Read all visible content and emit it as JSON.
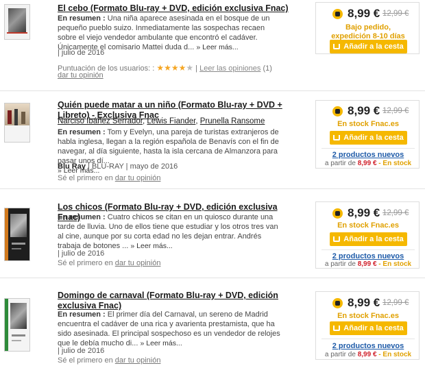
{
  "products": [
    {
      "title": "El cebo (Formato Blu-ray + DVD, edición exclusiva Fnac)",
      "summary_label": "En resumen :",
      "summary": "Una niña aparece asesinada en el bosque de un pequeño pueblo suizo. Inmediatamente las sospechas recaen sobre el viejo vendedor ambulante que encontró el cadáver. Únicamente el comisario Mattei duda d...",
      "more": "» Leer más...",
      "meta": "| julio de 2016",
      "rating_label": "Puntuación de los usuarios: :",
      "rating_stars": 4,
      "read_opinions": "Leer las opiniones",
      "opinions_count": "(1)",
      "opinion_link": "dar tu opinión",
      "price": "8,99 €",
      "old_price": "12,99 €",
      "availability": "Bajo pedido, expedición 8-10 días",
      "cart": "Añadir a la cesta"
    },
    {
      "title": "Quién puede matar a un niño (Formato Blu-ray + DVD + Libreto) - Exclusiva Fnac",
      "authors": [
        "Narciso Ibáñez Serrador",
        "Lewis Fiander",
        "Prunella Ransome"
      ],
      "summary_label": "En resumen :",
      "summary": "Tom y Evelyn, una pareja de turistas extranjeros de habla inglesa, llegan a la región española de Benavís con el fin de navegar, al día siguiente, hasta la isla cercana de Almanzora para pasar unos dí...",
      "more": "» Leer más...",
      "meta_bold": "Blu Ray",
      "meta": "| BLU-RAY | mayo de 2016",
      "opinion_prefix": "Sé el primero en",
      "opinion_link": "dar tu opinión",
      "price": "8,99 €",
      "old_price": "12,99 €",
      "availability": "En stock Fnac.es",
      "cart": "Añadir a la cesta",
      "used_link": "2 productos nuevos",
      "used_from": "a partir de",
      "used_price": "8,99 €",
      "used_stock": "- En stock"
    },
    {
      "title": "Los chicos (Formato Blu-ray + DVD, edición exclusiva Fnac)",
      "summary_label": "En resumen :",
      "summary": "Cuatro chicos se citan en un quiosco durante una tarde de lluvia. Uno de ellos tiene que estudiar y los otros tres van al cine, aunque por su corta edad no les dejan entrar. Andrés trabaja de botones ...",
      "more": "» Leer más...",
      "meta": "| julio de 2016",
      "opinion_prefix": "Sé el primero en",
      "opinion_link": "dar tu opinión",
      "price": "8,99 €",
      "old_price": "12,99 €",
      "availability": "En stock Fnac.es",
      "cart": "Añadir a la cesta",
      "used_link": "2 productos nuevos",
      "used_from": "a partir de",
      "used_price": "8,99 €",
      "used_stock": "- En stock"
    },
    {
      "title": "Domingo de carnaval (Formato Blu-ray + DVD, edición exclusiva Fnac)",
      "summary_label": "En resumen :",
      "summary": "El primer día del Carnaval, un sereno de Madrid encuentra el cadáver de una rica y avarienta prestamista, que ha sido asesinada. El principal sospechoso es un vendedor de relojes que le debía mucho di...",
      "more": "» Leer más...",
      "meta": "| julio de 2016",
      "opinion_prefix": "Sé el primero en",
      "opinion_link": "dar tu opinión",
      "price": "8,99 €",
      "old_price": "12,99 €",
      "availability": "En stock Fnac.es",
      "cart": "Añadir a la cesta",
      "used_link": "2 productos nuevos",
      "used_from": "a partir de",
      "used_price": "8,99 €",
      "used_stock": "- En stock"
    }
  ]
}
